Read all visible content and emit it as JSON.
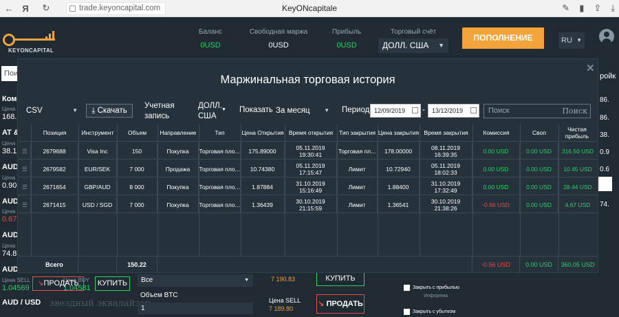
{
  "browser": {
    "back": "←",
    "yandex": "Я",
    "refresh": "↻",
    "url": "trade.keyoncapital.com",
    "title": "KeyONcapitale"
  },
  "header": {
    "logo_text": "KEYONCAPITAL",
    "balance_label": "Баланс",
    "balance_value": "0USD",
    "free_margin_label": "Свободная маржа",
    "free_margin_value": "0USD",
    "profit_label": "Прибыль",
    "profit_value": "0USD",
    "account_label": "Торговый счёт",
    "account_value": "ДОЛЛ. США",
    "deposit_button": "ПОПОЛНЕНИЕ",
    "language": "RU"
  },
  "background": {
    "search_placeholder": "Пои",
    "right_label": "ройк",
    "instruments": [
      {
        "symbol": "Ком",
        "price_label": "Цена",
        "price": "168."
      },
      {
        "symbol": "AT &",
        "price_label": "Цена",
        "price": "38.1"
      },
      {
        "symbol": "AUD",
        "price_label": "Цена",
        "price": "0.90"
      },
      {
        "symbol": "AUD",
        "price_label": "Цена",
        "price": "0.67"
      },
      {
        "symbol": "AUD",
        "price_label": "Цена",
        "price": "74.8"
      },
      {
        "symbol": "AUD",
        "price_label": "Цена SELL",
        "price": "1.04569"
      },
      {
        "symbol": "AUD / USD",
        "price_label": "",
        "price": ""
      }
    ],
    "right_values": [
      "86.",
      "86.",
      "38.",
      "0.9",
      "0.6",
      "74."
    ],
    "buy_label": "Цена BUY",
    "buy_value": "1.04581",
    "sell_button": "ПРОДАТЬ",
    "buy_button": "КУПИТЬ",
    "select_value": "Все",
    "volume_label": "Объем BTC",
    "volume_value": "1",
    "price_mid": "7 190.83",
    "buy_big": "КУПИТЬ",
    "sell_label_mid": "Цена SELL",
    "sell_value_mid": "7 189.80",
    "sell_big": "ПРОДАТЬ",
    "watermark": "звездный эквалайзер",
    "take_profit": "Закрыть с прибылью",
    "stop_loss": "Закрыть с убытком",
    "info_tag": "Инфорема"
  },
  "modal": {
    "title": "Маржинальная торговая история",
    "format_value": "CSV",
    "download_button": "Скачать",
    "account_label": "Учетная запись",
    "account_value": "ДОЛЛ. США",
    "show_label": "Показать",
    "show_value": "За месяц",
    "period_label": "Период",
    "date_from": "12/09/2019",
    "date_sep": "-",
    "date_to": "13/12/2019",
    "search_placeholder": "Поиск",
    "search_button": "Поиск",
    "columns": [
      "Позиция",
      "Инструмент",
      "Объем",
      "Направление",
      "Тип",
      "Цена Открытия",
      "Время открытия",
      "Тип закрытия",
      "Цена закрытия",
      "Время закрытия",
      "Комиссия",
      "Своп",
      "Чистая прибыль"
    ],
    "rows": [
      {
        "position": "2679688",
        "instrument": "Visa Inc",
        "volume": "150",
        "direction": "Покупка",
        "type": "Торговая пло...",
        "open_price": "175.89000",
        "open_time": "05.11.2019 19:30:41",
        "close_type": "Торговая пл...",
        "close_price": "178.00000",
        "close_time": "08.11.2019 16:39:35",
        "commission": "0.00 USD",
        "swap": "0.00 USD",
        "net_profit": "316.50 USD"
      },
      {
        "position": "2679582",
        "instrument": "EUR/SEK",
        "volume": "7 000",
        "direction": "Продажа",
        "type": "Торговая пло...",
        "open_price": "10.74380",
        "open_time": "05.11.2019 17:15:47",
        "close_type": "Лимит",
        "close_price": "10.72940",
        "close_time": "05.11.2019 18:02:33",
        "commission": "0.00 USD",
        "swap": "0.00 USD",
        "net_profit": "10.45 USD"
      },
      {
        "position": "2671654",
        "instrument": "GBP/AUD",
        "volume": "8 000",
        "direction": "Покупка",
        "type": "Торговая пло...",
        "open_price": "1.87884",
        "open_time": "31.10.2019 15:16:49",
        "close_type": "Лимит",
        "close_price": "1.88400",
        "close_time": "31.10.2019 17:32:49",
        "commission": "0.00 USD",
        "swap": "0.00 USD",
        "net_profit": "28.44 USD"
      },
      {
        "position": "2671415",
        "instrument": "USD / SGD",
        "volume": "7 000",
        "direction": "Покупка",
        "type": "Торговая пло...",
        "open_price": "1.36439",
        "open_time": "30.10.2019 21:15:59",
        "close_type": "Лимит",
        "close_price": "1.36541",
        "close_time": "30.10.2019 21:38:26",
        "commission": "-0.56 USD",
        "swap": "0.00 USD",
        "net_profit": "4.67 USD"
      }
    ],
    "totals": {
      "label": "Всего",
      "volume": "150.22",
      "commission": "-0.56 USD",
      "swap": "0.00 USD",
      "net_profit": "360,05 USD"
    }
  },
  "colors": {
    "accent": "#f2a33a",
    "positive": "#2ed06a",
    "negative": "#e84c4c",
    "background": "#1f2a33",
    "modal": "#25313b"
  }
}
